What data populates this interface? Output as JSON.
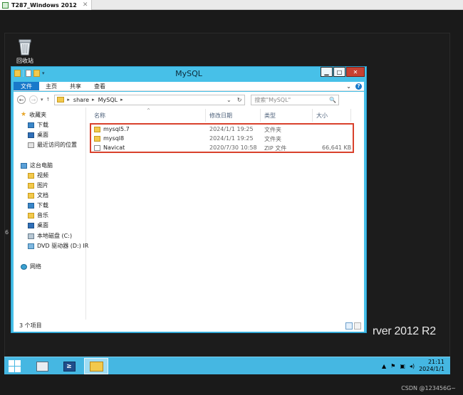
{
  "host": {
    "tab_title": "T287_Windows 2012",
    "tab_close": "✕"
  },
  "desktop": {
    "recycle_bin_label": "回收站",
    "brand_text": "rver 2012 R2",
    "side_mark": "6"
  },
  "window": {
    "title": "MySQL",
    "buttons": {
      "minimize": "▁",
      "maximize": "□",
      "close": "✕"
    },
    "ribbon_tabs": [
      "文件",
      "主页",
      "共享",
      "查看"
    ],
    "ribbon_expand": "⌄",
    "help": "?",
    "address": {
      "back": "←",
      "forward": "→",
      "recent": "▾",
      "up": "↑",
      "crumbs": [
        "share",
        "MySQL"
      ],
      "sep": "▸",
      "dropdown": "⌄",
      "refresh": "↻",
      "search_placeholder": "搜索\"MySQL\"",
      "search_icon": "🔍"
    },
    "nav": {
      "favorites": "收藏夹",
      "fav_items": [
        "下载",
        "桌面",
        "最近访问的位置"
      ],
      "this_pc": "这台电脑",
      "pc_items": [
        "视频",
        "图片",
        "文档",
        "下载",
        "音乐",
        "桌面",
        "本地磁盘 (C:)",
        "DVD 驱动器 (D:) IR"
      ],
      "network": "网络"
    },
    "columns": {
      "name": "名称",
      "modified": "修改日期",
      "type": "类型",
      "size": "大小",
      "sort_indicator": "^"
    },
    "files": [
      {
        "name": "mysql5.7",
        "modified": "2024/1/1 19:25",
        "type": "文件夹",
        "size": "",
        "icon": "folder-icon"
      },
      {
        "name": "mysql8",
        "modified": "2024/1/1 19:25",
        "type": "文件夹",
        "size": "",
        "icon": "folder-icon"
      },
      {
        "name": "Navicat",
        "modified": "2020/7/30 10:58",
        "type": "ZIP 文件",
        "size": "66,641 KB",
        "icon": "zip-icon"
      }
    ],
    "status_count": "3 个项目"
  },
  "taskbar": {
    "clock_time": "21:11",
    "clock_date": "2024/1/1",
    "tray_arrow": "▲",
    "powershell_glyph": "≥"
  },
  "watermark": "CSDN @123456G~",
  "colors": {
    "accent": "#47c0e8",
    "file_tab": "#1979ca",
    "highlight": "#d9412c",
    "taskbar": "#45b7e2"
  }
}
